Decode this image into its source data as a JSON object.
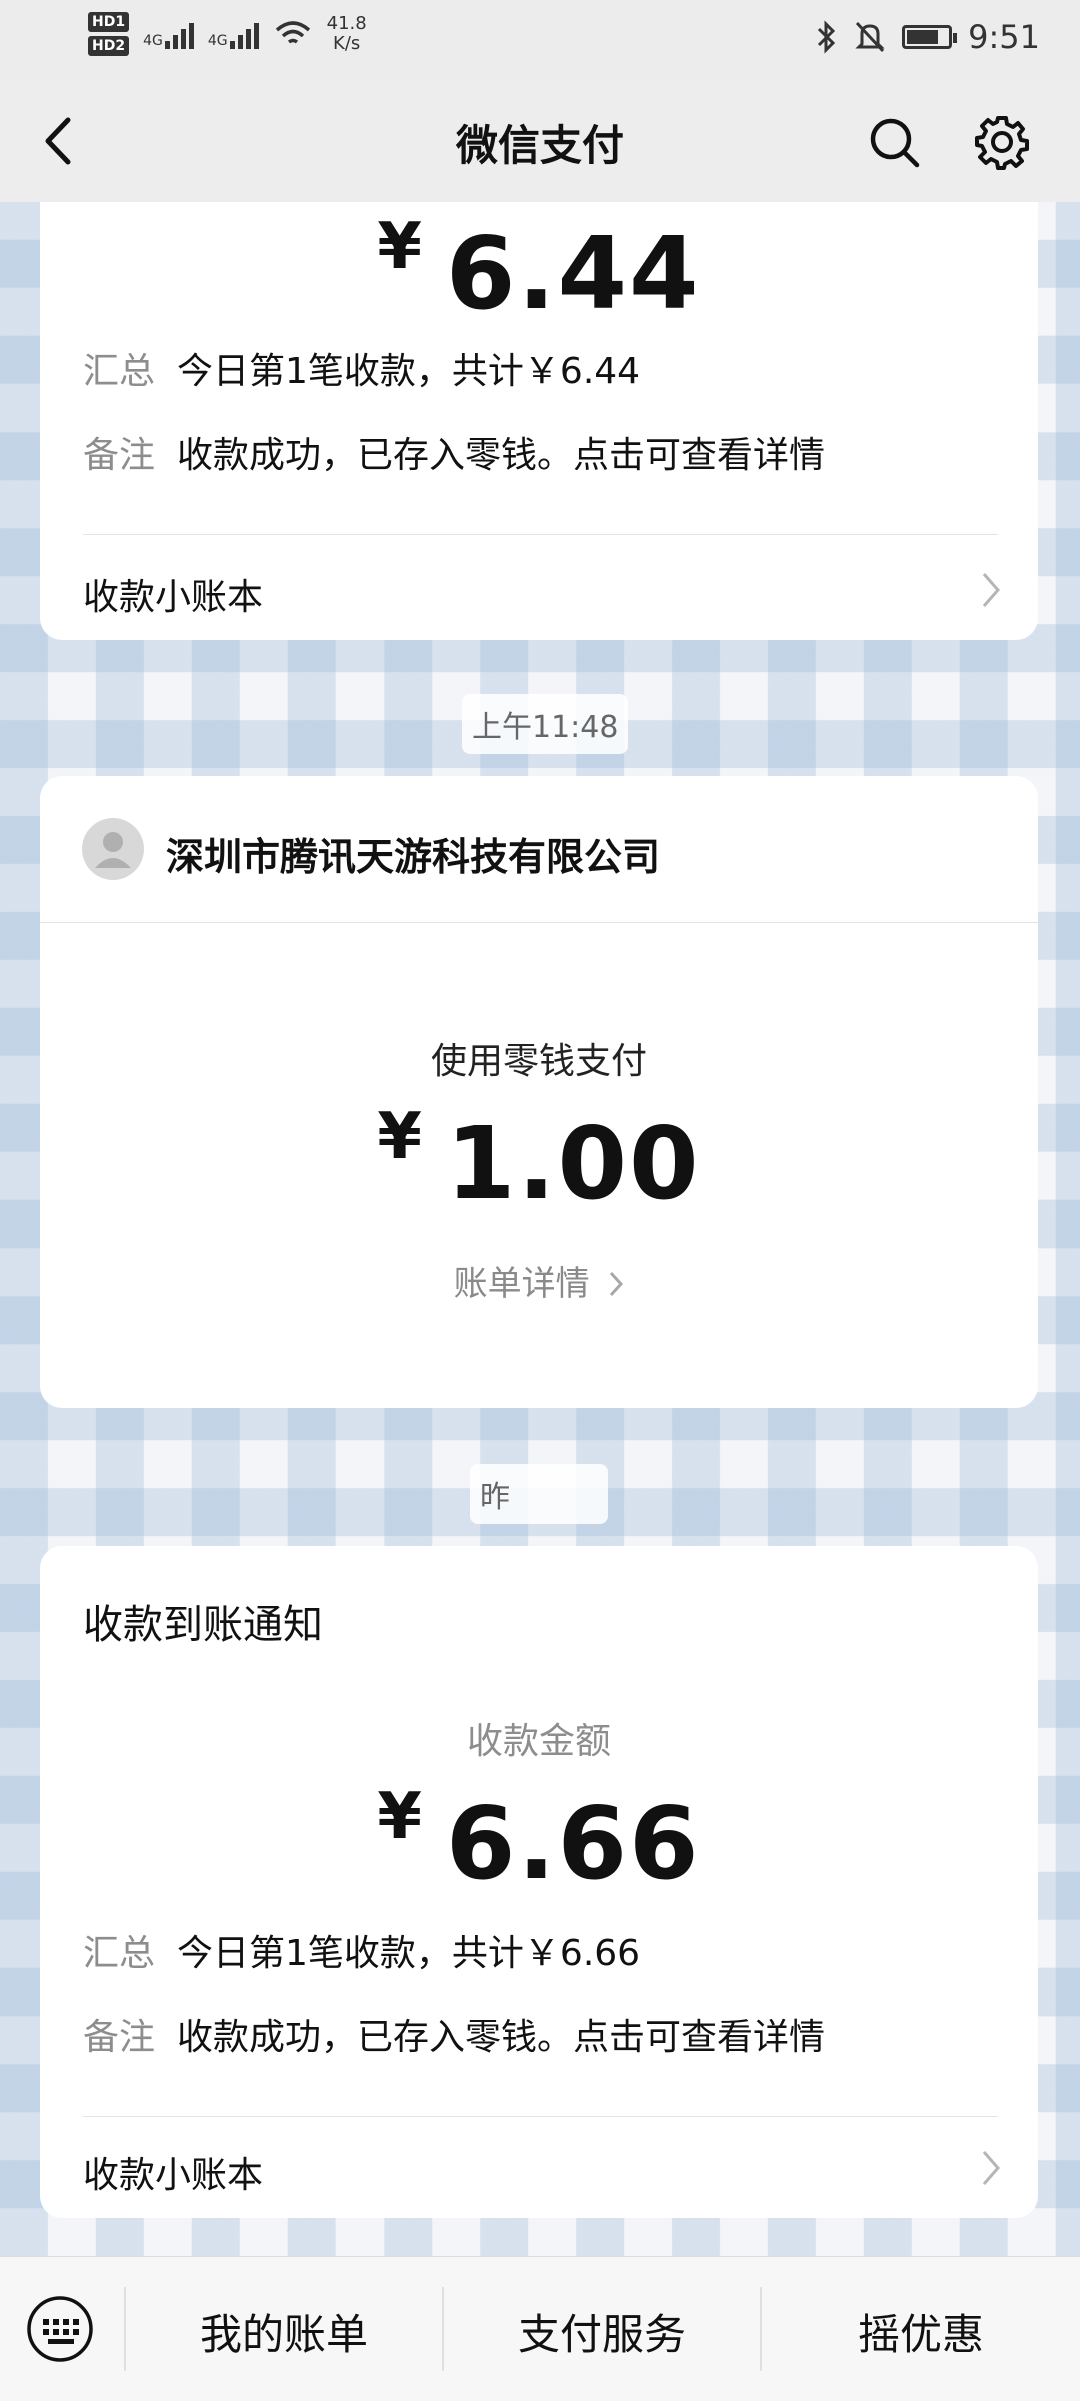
{
  "status_bar": {
    "hd1": "HD1",
    "hd2": "HD2",
    "sim1": "4G",
    "sim2": "4G",
    "net_speed": "41.8",
    "net_unit": "K/s",
    "time": "9:51",
    "icons": [
      "bluetooth-icon",
      "mute-icon",
      "battery-icon"
    ]
  },
  "nav": {
    "title": "微信支付",
    "icons": [
      "back-icon",
      "search-icon",
      "gear-icon"
    ]
  },
  "card1": {
    "amount_symbol": "¥",
    "amount": "6.44",
    "summary_label": "汇总",
    "summary_value": "今日第1笔收款，共计￥6.44",
    "note_label": "备注",
    "note_value": "收款成功，已存入零钱。点击可查看详情",
    "ledger": "收款小账本"
  },
  "chip1": "上午11:48",
  "card2": {
    "merchant": "深圳市腾讯天游科技有限公司",
    "payment_method": "使用零钱支付",
    "amount_symbol": "¥",
    "amount": "1.00",
    "bill_detail": "账单详情"
  },
  "chip2": "昨",
  "card3": {
    "title": "收款到账通知",
    "amount_label": "收款金额",
    "amount_symbol": "¥",
    "amount": "6.66",
    "summary_label": "汇总",
    "summary_value": "今日第1笔收款，共计￥6.66",
    "note_label": "备注",
    "note_value": "收款成功，已存入零钱。点击可查看详情",
    "ledger": "收款小账本"
  },
  "bottom_bar": {
    "tab1": "我的账单",
    "tab2": "支付服务",
    "tab3": "摇优惠"
  }
}
